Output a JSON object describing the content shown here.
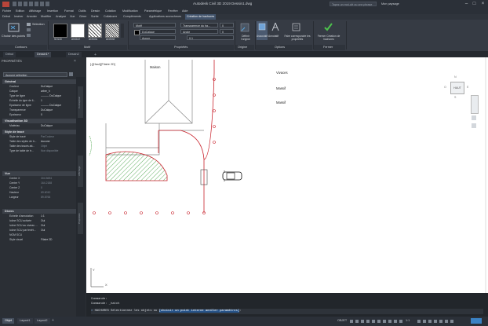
{
  "titlebar": {
    "title": "Autodesk Civil 3D 2019    Dessin1.dwg",
    "search_placeholder": "Tapez un mot-clé ou une phrase",
    "user": "Mon paysage"
  },
  "menubar": [
    "Fichier",
    "Edition",
    "Affichage",
    "Insertion",
    "Format",
    "Outils",
    "Dessin",
    "Cotation",
    "Modification",
    "Paramétrique",
    "Fenêtre",
    "Aide"
  ],
  "ribbon_tabs": [
    "Début",
    "Insérer",
    "Annoter",
    "Modifier",
    "Analyse",
    "Vue",
    "Gérer",
    "Sortie",
    "Collaborer",
    "Compléments",
    "Applications accrocheurs",
    "Création de hachures"
  ],
  "ribbon": {
    "limites": {
      "pick_label": "Choisir des points",
      "select_label": "Sélection",
      "panel": "Contours"
    },
    "motif": {
      "panel": "Motif",
      "patterns": [
        "SOLID",
        "ANGLE",
        "ANSI31",
        "ANSI32"
      ]
    },
    "proprietes": {
      "panel": "Propriétés",
      "type": "Motif",
      "color": "DuCalque",
      "bg": "Aucun",
      "transparency": "Transparence du ha...",
      "transparency_val": "0",
      "angle": "Angle",
      "angle_val": "0",
      "scale": "0.1"
    },
    "origine": {
      "panel": "Origine",
      "label": "Définir l'origine"
    },
    "options": {
      "panel": "Options",
      "associative": "Associatif",
      "annotative": "Annotatif",
      "match": "Faire correspondre les propriétés"
    },
    "fermer": {
      "panel": "Fermer",
      "label": "Fermer Création de hachures"
    }
  },
  "doc_tabs": [
    "Début",
    "Dessin1*",
    "Dessin2"
  ],
  "palette": {
    "title": "PROPRIÉTÉS",
    "selection": "Aucune sélection",
    "sections": [
      {
        "name": "Général",
        "rows": [
          [
            "Couleur",
            "DuCalque"
          ],
          [
            "Calque",
            "arbre_h"
          ],
          [
            "Type de ligne",
            "——— DuCalque"
          ],
          [
            "Echelle du type de li...",
            "1"
          ],
          [
            "Epaisseur de ligne",
            "——— DuCalque"
          ],
          [
            "Transparence",
            "DuCalque"
          ],
          [
            "Epaisseur",
            "0"
          ]
        ]
      },
      {
        "name": "Visualisation 3D",
        "rows": [
          [
            "Matériau",
            "DuCalque"
          ]
        ]
      },
      {
        "name": "Style de tracé",
        "rows": [
          [
            "Style de tracé",
            "ParCouleur"
          ],
          [
            "Table des styles de tr...",
            "Aucune"
          ],
          [
            "Table des tracés att...",
            "Objet"
          ],
          [
            "Type de table de tr...",
            "Non disponible"
          ]
        ]
      },
      {
        "name": "Vue",
        "rows": [
          [
            "Centre X",
            "304.5694"
          ],
          [
            "Centre Y",
            "164.2188"
          ],
          [
            "Centre Z",
            "0"
          ],
          [
            "Hauteur",
            "69.6010"
          ],
          [
            "Largeur",
            "89.8766"
          ]
        ]
      },
      {
        "name": "Divers",
        "rows": [
          [
            "Echelle d'annotation",
            "1:1"
          ],
          [
            "Icône SCU activée",
            "Oui"
          ],
          [
            "Icône SCU au niveau ...",
            "Oui"
          ],
          [
            "Icône SCU par fenêt...",
            "Oui"
          ],
          [
            "NOM SCU",
            ""
          ],
          [
            "Style visuel",
            "Filaire 2D"
          ]
        ]
      }
    ],
    "side_tabs": [
      "Conception",
      "Affichage",
      "Propriétés"
    ]
  },
  "drawing": {
    "view_label": "[-][Haut][Filaire 2D]",
    "texts": [
      "Maison",
      "Vivaces",
      "Massif",
      "Massif"
    ],
    "viewcube": {
      "top": "HAUT",
      "n": "N",
      "s": "S",
      "o": "O",
      "e": "E"
    }
  },
  "command": {
    "history": [
      "Commande:",
      "Commande: _hatch"
    ],
    "prompt_prefix": "HACHURES Sélectionnez les objets ou ",
    "prompt_highlight": "[choisir un point interne annUler paramètres]",
    "prompt_suffix": ":"
  },
  "statusbar": {
    "tabs": [
      "Objet",
      "Layout1",
      "Layout2"
    ],
    "model": "OBJET",
    "scale": "1:1"
  },
  "colors": {
    "hatch_red": "#c8202a",
    "hatch_green": "#3a9b3a",
    "accent": "#3b82c4"
  }
}
